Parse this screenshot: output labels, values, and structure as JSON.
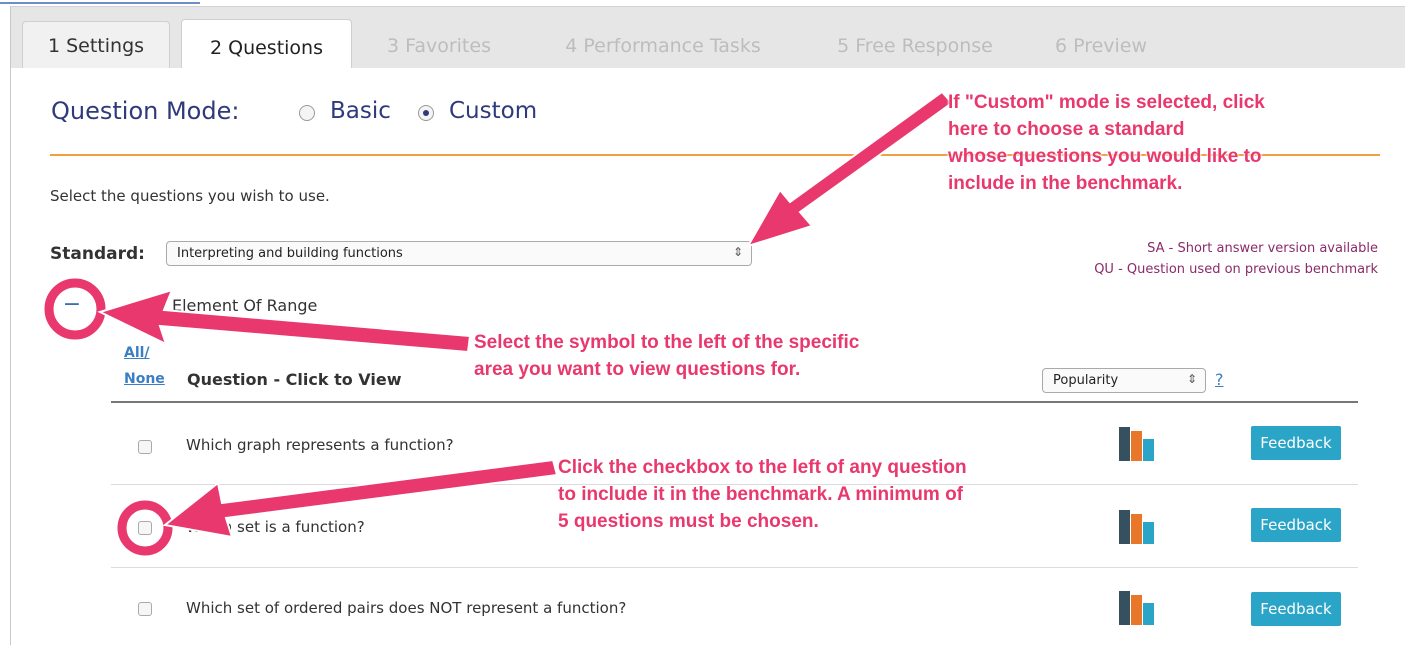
{
  "tabs": [
    {
      "label": "1 Settings",
      "state": "enabled"
    },
    {
      "label": "2 Questions",
      "state": "active"
    },
    {
      "label": "3 Favorites",
      "state": "disabled"
    },
    {
      "label": "4 Performance Tasks",
      "state": "disabled"
    },
    {
      "label": "5 Free Response",
      "state": "disabled"
    },
    {
      "label": "6 Preview",
      "state": "disabled"
    }
  ],
  "question_mode": {
    "title": "Question Mode:",
    "options": [
      "Basic",
      "Custom"
    ],
    "selected": "Custom"
  },
  "instructions": "Select the questions you wish to use.",
  "standard": {
    "label": "Standard:",
    "value": "Interpreting and building functions",
    "arrow": "⇕"
  },
  "legend": {
    "sa": "SA - Short answer version available",
    "qu": "QU - Question used on previous benchmark"
  },
  "category": {
    "toggle": "−",
    "title": "Element Of Range"
  },
  "table": {
    "all_label": "All/",
    "none_label": "None",
    "header": "Question - Click to View",
    "sort_value": "Popularity",
    "sort_arrow": "⇕",
    "help": "?",
    "questions": [
      {
        "text": "Which graph represents a function?",
        "button": "Feedback"
      },
      {
        "text": "Which set is a function?",
        "button": "Feedback"
      },
      {
        "text": "Which set of ordered pairs does NOT represent a function?",
        "button": "Feedback"
      }
    ]
  },
  "annotations": {
    "custom_note": [
      "If \"Custom\" mode is selected, click",
      "here to choose a standard",
      "whose questions you would like to",
      "include in the benchmark."
    ],
    "symbol_note": [
      "Select the symbol to the left of the specific",
      "area you want to view questions for."
    ],
    "checkbox_note": [
      "Click the checkbox to the left of any question",
      "to include it in the benchmark. A minimum of",
      "5 questions must be chosen."
    ]
  },
  "colors": {
    "annotation": "#e8386e",
    "accent_blue": "#2e3a7a",
    "feedback_button": "#2ba5c7",
    "rule_orange": "#f0a040",
    "bar_dark": "#35505e",
    "bar_orange": "#e8772a",
    "bar_teal": "#2ba5c7"
  },
  "icons": {
    "stats": "bar-chart-icon",
    "select_arrow": "updown-arrow-icon"
  }
}
